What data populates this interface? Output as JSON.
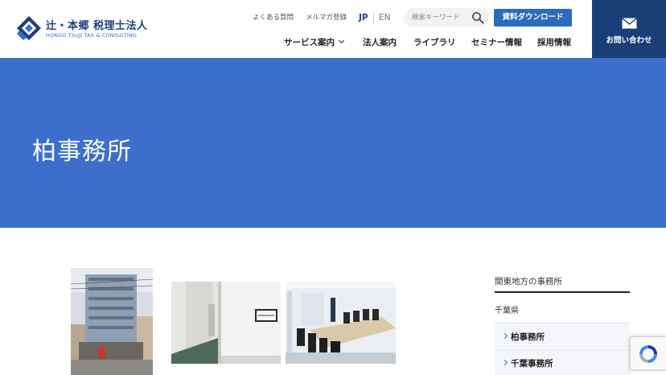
{
  "brand": {
    "name_jp": "辻・本郷 税理士法人",
    "name_en": "HONGO TSUJI TAX & CONSULTING"
  },
  "header": {
    "util_links": [
      "よくある質問",
      "メルマガ登録"
    ],
    "lang": {
      "jp": "JP",
      "en": "EN",
      "active": "JP"
    },
    "search": {
      "placeholder": "検索キーワード",
      "value": ""
    },
    "download_button": "資料ダウンロード",
    "contact_button": "お問い合わせ",
    "nav": [
      "サービス案内",
      "法人案内",
      "ライブラリ",
      "セミナー情報",
      "採用情報"
    ]
  },
  "hero": {
    "title": "柏事務所"
  },
  "sidebar": {
    "heading": "関東地方の事務所",
    "prefecture": "千葉県",
    "items": [
      "柏事務所",
      "千葉事務所"
    ]
  },
  "colors": {
    "hero_blue": "#3b6fcb",
    "navy": "#1a3e78",
    "button_blue": "#2a6bbf"
  },
  "icons": [
    "logo-mark",
    "search-icon",
    "mail-icon",
    "chevron-down-icon",
    "chevron-right-icon",
    "recaptcha-icon"
  ]
}
